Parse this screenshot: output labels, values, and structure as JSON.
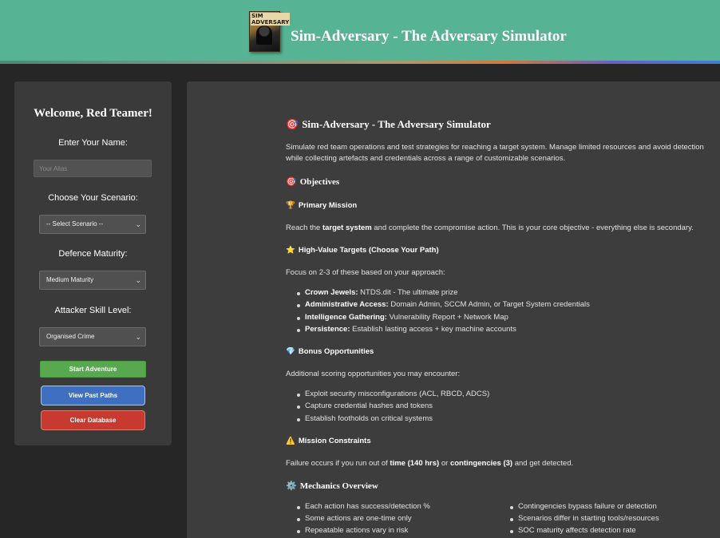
{
  "header": {
    "title": "Sim-Adversary - The Adversary Simulator",
    "logo_text": "SIM ADVERSARY"
  },
  "sidebar": {
    "welcome": "Welcome, Red Teamer!",
    "name_label": "Enter Your Name:",
    "name_placeholder": "Your Alias",
    "scenario_label": "Choose Your Scenario:",
    "scenario_value": "-- Select Scenario --",
    "maturity_label": "Defence Maturity:",
    "maturity_value": "Medium Maturity",
    "skill_label": "Attacker Skill Level:",
    "skill_value": "Organised Crime",
    "start_button": "Start Adventure",
    "past_button": "View Past Paths",
    "clear_button": "Clear Database"
  },
  "main": {
    "title_icon": "🎯",
    "title": "Sim-Adversary - The Adversary Simulator",
    "intro": "Simulate red team operations and test strategies for reaching a target system. Manage limited resources and avoid detection while collecting artefacts and credentials across a range of customizable scenarios.",
    "objectives_icon": "🎯",
    "objectives_heading": "Objectives",
    "primary_icon": "🏆",
    "primary_heading": "Primary Mission",
    "primary_text_pre": "Reach the ",
    "primary_text_bold": "target system",
    "primary_text_post": " and complete the compromise action. This is your core objective - everything else is secondary.",
    "hvt_icon": "⭐",
    "hvt_heading": "High-Value Targets (Choose Your Path)",
    "hvt_intro": "Focus on 2-3 of these based on your approach:",
    "hvt_items": [
      {
        "bold": "Crown Jewels:",
        "text": " NTDS.dit - The ultimate prize"
      },
      {
        "bold": "Administrative Access:",
        "text": " Domain Admin, SCCM Admin, or Target System credentials"
      },
      {
        "bold": "Intelligence Gathering:",
        "text": " Vulnerability Report + Network Map"
      },
      {
        "bold": "Persistence:",
        "text": " Establish lasting access + key machine accounts"
      }
    ],
    "bonus_icon": "💎",
    "bonus_heading": "Bonus Opportunities",
    "bonus_intro": "Additional scoring opportunities you may encounter:",
    "bonus_items": [
      "Exploit security misconfigurations (ACL, RBCD, ADCS)",
      "Capture credential hashes and tokens",
      "Establish footholds on critical systems"
    ],
    "constraints_icon": "⚠️",
    "constraints_heading": "Mission Constraints",
    "constraints_pre": "Failure occurs if you run out of ",
    "constraints_time": "time (140 hrs)",
    "constraints_mid": " or ",
    "constraints_cont": "contingencies (3)",
    "constraints_post": " and get detected.",
    "mechanics_icon": "⚙️",
    "mechanics_heading": "Mechanics Overview",
    "mechanics_left": [
      "Each action has success/detection %",
      "Some actions are one-time only",
      "Repeatable actions vary in risk"
    ],
    "mechanics_right": [
      "Contingencies bypass failure or detection",
      "Scenarios differ in starting tools/resources",
      "SOC maturity affects detection rate"
    ]
  }
}
